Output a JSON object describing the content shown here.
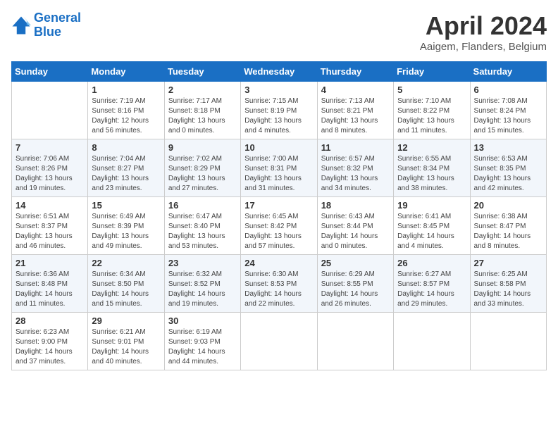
{
  "header": {
    "logo_line1": "General",
    "logo_line2": "Blue",
    "title": "April 2024",
    "location": "Aaigem, Flanders, Belgium"
  },
  "days_of_week": [
    "Sunday",
    "Monday",
    "Tuesday",
    "Wednesday",
    "Thursday",
    "Friday",
    "Saturday"
  ],
  "weeks": [
    [
      {
        "day": "",
        "sunrise": "",
        "sunset": "",
        "daylight": ""
      },
      {
        "day": "1",
        "sunrise": "Sunrise: 7:19 AM",
        "sunset": "Sunset: 8:16 PM",
        "daylight": "Daylight: 12 hours and 56 minutes."
      },
      {
        "day": "2",
        "sunrise": "Sunrise: 7:17 AM",
        "sunset": "Sunset: 8:18 PM",
        "daylight": "Daylight: 13 hours and 0 minutes."
      },
      {
        "day": "3",
        "sunrise": "Sunrise: 7:15 AM",
        "sunset": "Sunset: 8:19 PM",
        "daylight": "Daylight: 13 hours and 4 minutes."
      },
      {
        "day": "4",
        "sunrise": "Sunrise: 7:13 AM",
        "sunset": "Sunset: 8:21 PM",
        "daylight": "Daylight: 13 hours and 8 minutes."
      },
      {
        "day": "5",
        "sunrise": "Sunrise: 7:10 AM",
        "sunset": "Sunset: 8:22 PM",
        "daylight": "Daylight: 13 hours and 11 minutes."
      },
      {
        "day": "6",
        "sunrise": "Sunrise: 7:08 AM",
        "sunset": "Sunset: 8:24 PM",
        "daylight": "Daylight: 13 hours and 15 minutes."
      }
    ],
    [
      {
        "day": "7",
        "sunrise": "Sunrise: 7:06 AM",
        "sunset": "Sunset: 8:26 PM",
        "daylight": "Daylight: 13 hours and 19 minutes."
      },
      {
        "day": "8",
        "sunrise": "Sunrise: 7:04 AM",
        "sunset": "Sunset: 8:27 PM",
        "daylight": "Daylight: 13 hours and 23 minutes."
      },
      {
        "day": "9",
        "sunrise": "Sunrise: 7:02 AM",
        "sunset": "Sunset: 8:29 PM",
        "daylight": "Daylight: 13 hours and 27 minutes."
      },
      {
        "day": "10",
        "sunrise": "Sunrise: 7:00 AM",
        "sunset": "Sunset: 8:31 PM",
        "daylight": "Daylight: 13 hours and 31 minutes."
      },
      {
        "day": "11",
        "sunrise": "Sunrise: 6:57 AM",
        "sunset": "Sunset: 8:32 PM",
        "daylight": "Daylight: 13 hours and 34 minutes."
      },
      {
        "day": "12",
        "sunrise": "Sunrise: 6:55 AM",
        "sunset": "Sunset: 8:34 PM",
        "daylight": "Daylight: 13 hours and 38 minutes."
      },
      {
        "day": "13",
        "sunrise": "Sunrise: 6:53 AM",
        "sunset": "Sunset: 8:35 PM",
        "daylight": "Daylight: 13 hours and 42 minutes."
      }
    ],
    [
      {
        "day": "14",
        "sunrise": "Sunrise: 6:51 AM",
        "sunset": "Sunset: 8:37 PM",
        "daylight": "Daylight: 13 hours and 46 minutes."
      },
      {
        "day": "15",
        "sunrise": "Sunrise: 6:49 AM",
        "sunset": "Sunset: 8:39 PM",
        "daylight": "Daylight: 13 hours and 49 minutes."
      },
      {
        "day": "16",
        "sunrise": "Sunrise: 6:47 AM",
        "sunset": "Sunset: 8:40 PM",
        "daylight": "Daylight: 13 hours and 53 minutes."
      },
      {
        "day": "17",
        "sunrise": "Sunrise: 6:45 AM",
        "sunset": "Sunset: 8:42 PM",
        "daylight": "Daylight: 13 hours and 57 minutes."
      },
      {
        "day": "18",
        "sunrise": "Sunrise: 6:43 AM",
        "sunset": "Sunset: 8:44 PM",
        "daylight": "Daylight: 14 hours and 0 minutes."
      },
      {
        "day": "19",
        "sunrise": "Sunrise: 6:41 AM",
        "sunset": "Sunset: 8:45 PM",
        "daylight": "Daylight: 14 hours and 4 minutes."
      },
      {
        "day": "20",
        "sunrise": "Sunrise: 6:38 AM",
        "sunset": "Sunset: 8:47 PM",
        "daylight": "Daylight: 14 hours and 8 minutes."
      }
    ],
    [
      {
        "day": "21",
        "sunrise": "Sunrise: 6:36 AM",
        "sunset": "Sunset: 8:48 PM",
        "daylight": "Daylight: 14 hours and 11 minutes."
      },
      {
        "day": "22",
        "sunrise": "Sunrise: 6:34 AM",
        "sunset": "Sunset: 8:50 PM",
        "daylight": "Daylight: 14 hours and 15 minutes."
      },
      {
        "day": "23",
        "sunrise": "Sunrise: 6:32 AM",
        "sunset": "Sunset: 8:52 PM",
        "daylight": "Daylight: 14 hours and 19 minutes."
      },
      {
        "day": "24",
        "sunrise": "Sunrise: 6:30 AM",
        "sunset": "Sunset: 8:53 PM",
        "daylight": "Daylight: 14 hours and 22 minutes."
      },
      {
        "day": "25",
        "sunrise": "Sunrise: 6:29 AM",
        "sunset": "Sunset: 8:55 PM",
        "daylight": "Daylight: 14 hours and 26 minutes."
      },
      {
        "day": "26",
        "sunrise": "Sunrise: 6:27 AM",
        "sunset": "Sunset: 8:57 PM",
        "daylight": "Daylight: 14 hours and 29 minutes."
      },
      {
        "day": "27",
        "sunrise": "Sunrise: 6:25 AM",
        "sunset": "Sunset: 8:58 PM",
        "daylight": "Daylight: 14 hours and 33 minutes."
      }
    ],
    [
      {
        "day": "28",
        "sunrise": "Sunrise: 6:23 AM",
        "sunset": "Sunset: 9:00 PM",
        "daylight": "Daylight: 14 hours and 37 minutes."
      },
      {
        "day": "29",
        "sunrise": "Sunrise: 6:21 AM",
        "sunset": "Sunset: 9:01 PM",
        "daylight": "Daylight: 14 hours and 40 minutes."
      },
      {
        "day": "30",
        "sunrise": "Sunrise: 6:19 AM",
        "sunset": "Sunset: 9:03 PM",
        "daylight": "Daylight: 14 hours and 44 minutes."
      },
      {
        "day": "",
        "sunrise": "",
        "sunset": "",
        "daylight": ""
      },
      {
        "day": "",
        "sunrise": "",
        "sunset": "",
        "daylight": ""
      },
      {
        "day": "",
        "sunrise": "",
        "sunset": "",
        "daylight": ""
      },
      {
        "day": "",
        "sunrise": "",
        "sunset": "",
        "daylight": ""
      }
    ]
  ]
}
